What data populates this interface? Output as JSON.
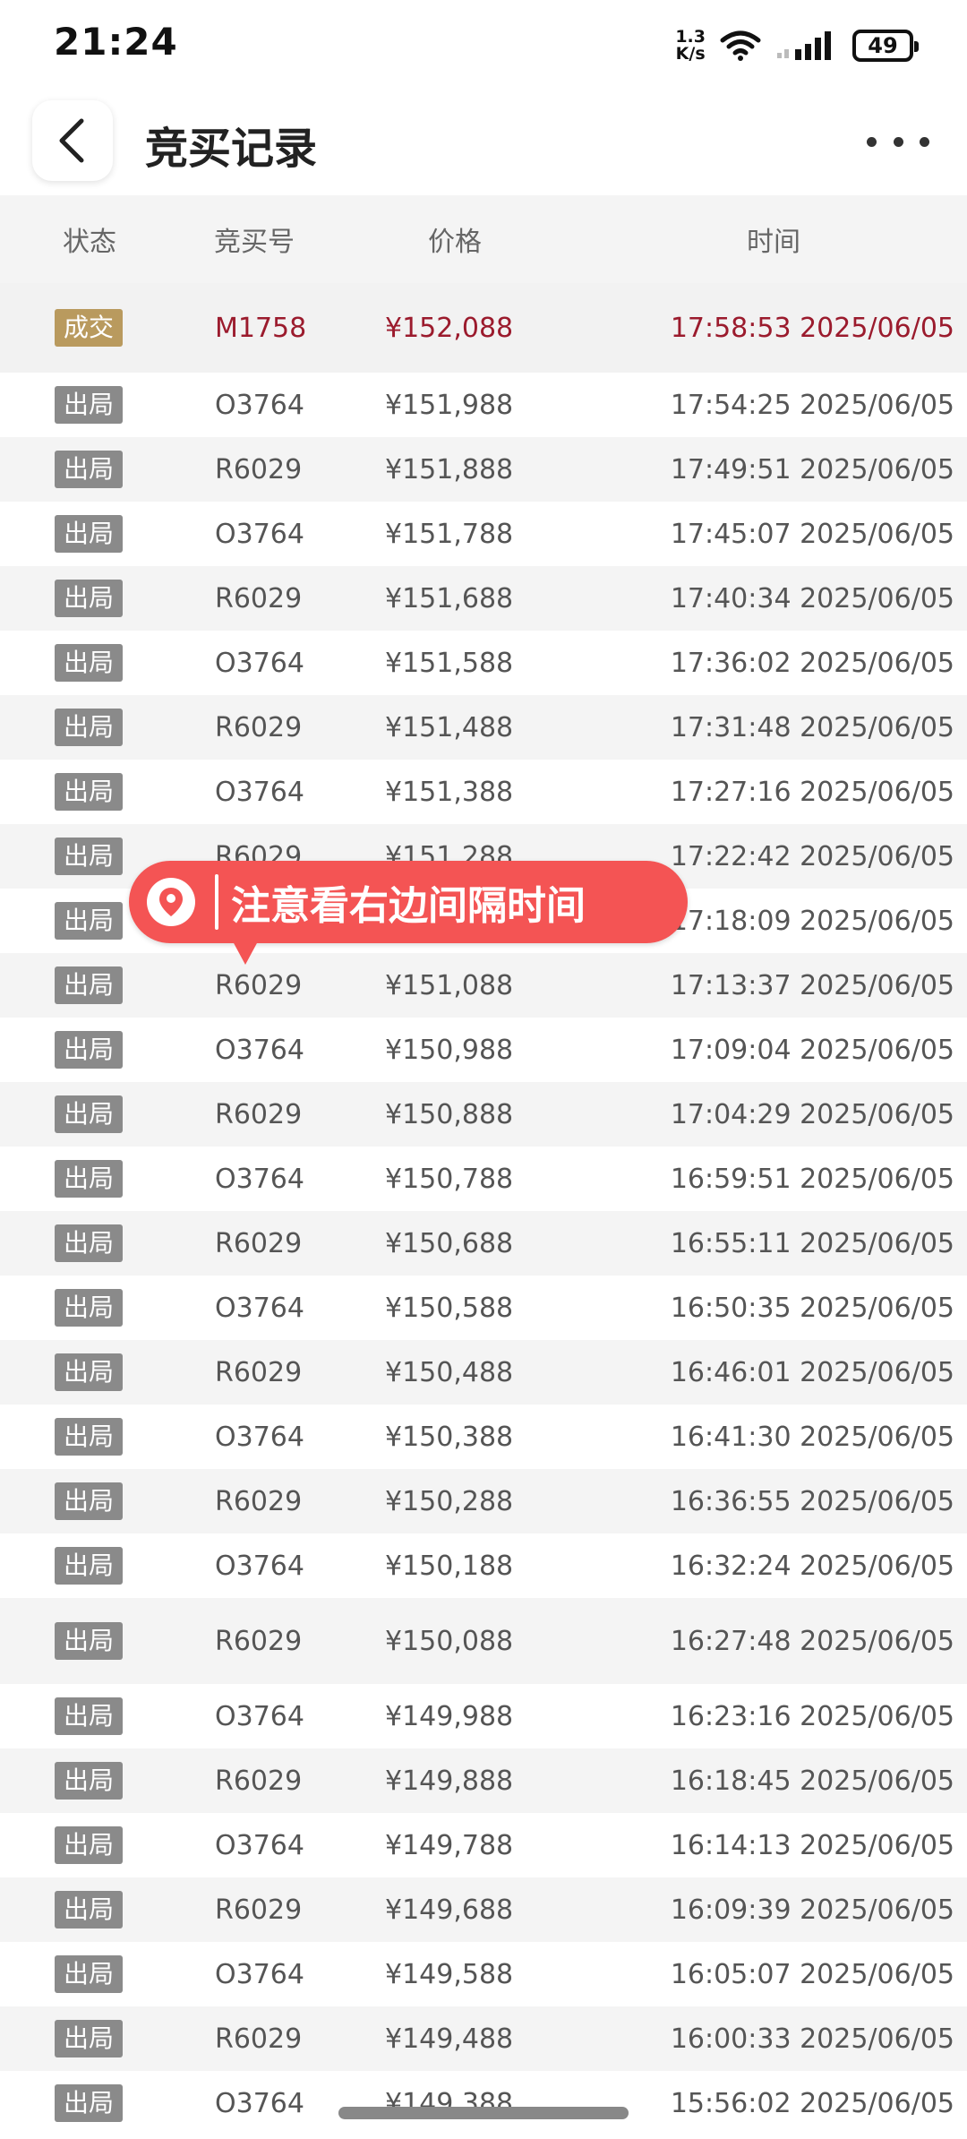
{
  "status_bar": {
    "time": "21:24",
    "speed_top": "1.3",
    "speed_bottom": "K/s",
    "battery": "49"
  },
  "header": {
    "title": "竞买记录"
  },
  "table": {
    "columns": [
      "状态",
      "竞买号",
      "价格",
      "时间"
    ],
    "rows": [
      {
        "status": "成交",
        "bidder": "M1758",
        "price": "¥152,088",
        "time": "17:58:53 2025/06/05"
      },
      {
        "status": "出局",
        "bidder": "O3764",
        "price": "¥151,988",
        "time": "17:54:25 2025/06/05"
      },
      {
        "status": "出局",
        "bidder": "R6029",
        "price": "¥151,888",
        "time": "17:49:51 2025/06/05"
      },
      {
        "status": "出局",
        "bidder": "O3764",
        "price": "¥151,788",
        "time": "17:45:07 2025/06/05"
      },
      {
        "status": "出局",
        "bidder": "R6029",
        "price": "¥151,688",
        "time": "17:40:34 2025/06/05"
      },
      {
        "status": "出局",
        "bidder": "O3764",
        "price": "¥151,588",
        "time": "17:36:02 2025/06/05"
      },
      {
        "status": "出局",
        "bidder": "R6029",
        "price": "¥151,488",
        "time": "17:31:48 2025/06/05"
      },
      {
        "status": "出局",
        "bidder": "O3764",
        "price": "¥151,388",
        "time": "17:27:16 2025/06/05"
      },
      {
        "status": "出局",
        "bidder": "R6029",
        "price": "¥151,288",
        "time": "17:22:42 2025/06/05"
      },
      {
        "status": "出局",
        "bidder": "",
        "price": "",
        "time": "17:18:09 2025/06/05"
      },
      {
        "status": "出局",
        "bidder": "R6029",
        "price": "¥151,088",
        "time": "17:13:37 2025/06/05"
      },
      {
        "status": "出局",
        "bidder": "O3764",
        "price": "¥150,988",
        "time": "17:09:04 2025/06/05"
      },
      {
        "status": "出局",
        "bidder": "R6029",
        "price": "¥150,888",
        "time": "17:04:29 2025/06/05"
      },
      {
        "status": "出局",
        "bidder": "O3764",
        "price": "¥150,788",
        "time": "16:59:51 2025/06/05"
      },
      {
        "status": "出局",
        "bidder": "R6029",
        "price": "¥150,688",
        "time": "16:55:11 2025/06/05"
      },
      {
        "status": "出局",
        "bidder": "O3764",
        "price": "¥150,588",
        "time": "16:50:35 2025/06/05"
      },
      {
        "status": "出局",
        "bidder": "R6029",
        "price": "¥150,488",
        "time": "16:46:01 2025/06/05"
      },
      {
        "status": "出局",
        "bidder": "O3764",
        "price": "¥150,388",
        "time": "16:41:30 2025/06/05"
      },
      {
        "status": "出局",
        "bidder": "R6029",
        "price": "¥150,288",
        "time": "16:36:55 2025/06/05"
      },
      {
        "status": "出局",
        "bidder": "O3764",
        "price": "¥150,188",
        "time": "16:32:24 2025/06/05"
      },
      {
        "status": "出局",
        "bidder": "R6029",
        "price": "¥150,088",
        "time": "16:27:48 2025/06/05"
      },
      {
        "status": "出局",
        "bidder": "O3764",
        "price": "¥149,988",
        "time": "16:23:16 2025/06/05"
      },
      {
        "status": "出局",
        "bidder": "R6029",
        "price": "¥149,888",
        "time": "16:18:45 2025/06/05"
      },
      {
        "status": "出局",
        "bidder": "O3764",
        "price": "¥149,788",
        "time": "16:14:13 2025/06/05"
      },
      {
        "status": "出局",
        "bidder": "R6029",
        "price": "¥149,688",
        "time": "16:09:39 2025/06/05"
      },
      {
        "status": "出局",
        "bidder": "O3764",
        "price": "¥149,588",
        "time": "16:05:07 2025/06/05"
      },
      {
        "status": "出局",
        "bidder": "R6029",
        "price": "¥149,488",
        "time": "16:00:33 2025/06/05"
      },
      {
        "status": "出局",
        "bidder": "O3764",
        "price": "¥149,388",
        "time": "15:56:02 2025/06/05"
      }
    ]
  },
  "annotation": {
    "text": "注意看右边间隔时间"
  },
  "colors": {
    "deal_badge": "#b99a5e",
    "out_badge": "#8a8a8a",
    "deal_text": "#9b1b2d",
    "annotation_bg": "#f45454"
  }
}
